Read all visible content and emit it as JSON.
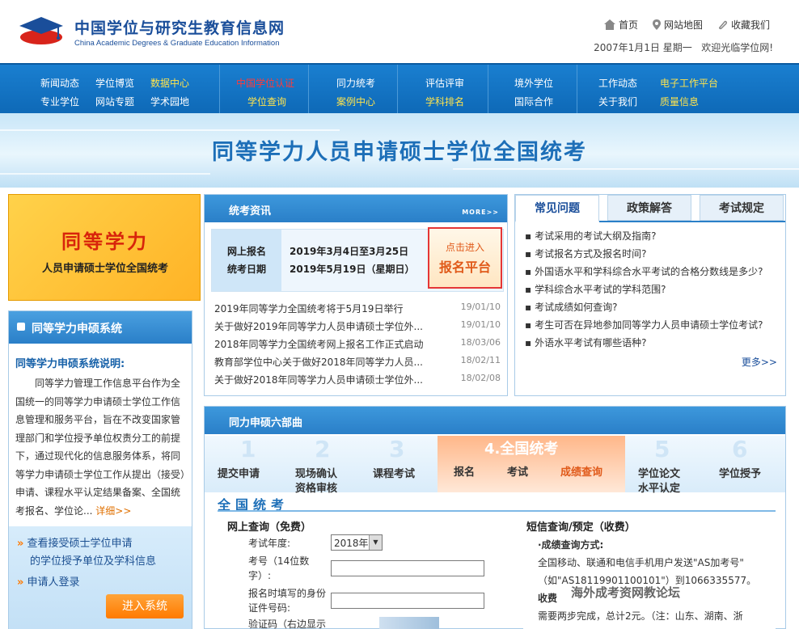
{
  "header": {
    "title": "中国学位与研究生教育信息网",
    "subtitle": "China Academic Degrees & Graduate Education Information",
    "links": [
      "首页",
      "网站地图",
      "收藏我们"
    ],
    "date": "2007年1月1日 星期一",
    "welcome": "欢迎光临学位网!"
  },
  "nav": {
    "rows": [
      [
        "新闻动态",
        "学位博览",
        "数据中心"
      ],
      [
        "专业学位",
        "网站专题",
        "学术园地"
      ]
    ],
    "col2": [
      "中国学位认证",
      "学位查询"
    ],
    "col3": [
      "同力统考",
      "案例中心"
    ],
    "col4": [
      "评估评审",
      "学科排名"
    ],
    "col5": [
      "境外学位",
      "国际合作"
    ],
    "col6a": [
      "工作动态",
      "关于我们"
    ],
    "col6b": [
      "电子工作平台",
      "质量信息"
    ]
  },
  "banner": {
    "title": "同等学力人员申请硕士学位全国统考"
  },
  "promo": {
    "title": "同等学力",
    "subtitle": "人员申请硕士学位全国统考"
  },
  "left_box": {
    "heading": "同等学力申硕系统",
    "sub": "同等学力申硕系统说明:",
    "text": "同等学力管理工作信息平台作为全国统一的同等学力申请硕士学位工作信息管理和服务平台，旨在不改变国家管理部门和学位授予单位权责分工的前提下，通过现代化的信息服务体系，将同等学力申请硕士学位工作从提出（接受）申请、课程水平认定结果备案、全国统考报名、学位论...",
    "more": "详细>>",
    "link1a": "查看接受硕士学位申请",
    "link1b": "的学位授予单位及学科信息",
    "link2": "申请人登录",
    "enter": "进入系统"
  },
  "news": {
    "heading": "统考资讯",
    "more": "MORE>>",
    "reg_label1": "网上报名",
    "reg_label2": "统考日期",
    "reg_value1": "2019年3月4日至3月25日",
    "reg_value2": "2019年5月19日（星期日）",
    "reg_btn_a": "点击进入",
    "reg_btn_b": "报名平台",
    "items": [
      {
        "title": "2019年同等学力全国统考将于5月19日举行",
        "date": "19/01/10"
      },
      {
        "title": "关于做好2019年同等学力人员申请硕士学位外...",
        "date": "19/01/10"
      },
      {
        "title": "2018年同等学力全国统考网上报名工作正式启动",
        "date": "18/03/06"
      },
      {
        "title": "教育部学位中心关于做好2018年同等学力人员...",
        "date": "18/02/11"
      },
      {
        "title": "关于做好2018年同等学力人员申请硕士学位外...",
        "date": "18/02/08"
      }
    ]
  },
  "faq": {
    "tabs": [
      "常见问题",
      "政策解答",
      "考试规定"
    ],
    "items": [
      "考试采用的考试大纲及指南?",
      "考试报名方式及报名时间?",
      "外国语水平和学科综合水平考试的合格分数线是多少?",
      "学科综合水平考试的学科范围?",
      "考试成绩如何查询?",
      "考生可否在异地参加同等学力人员申请硕士学位考试?",
      "外语水平考试有哪些语种?"
    ],
    "more": "更多>>"
  },
  "six": {
    "heading": "同力申硕六部曲",
    "steps": [
      {
        "num": "1",
        "label": "提交申请"
      },
      {
        "num": "2",
        "label": "现场确认",
        "label2": "资格审核"
      },
      {
        "num": "3",
        "label": "课程考试"
      },
      {
        "num": "5",
        "label": "学位论文",
        "label2": "水平认定"
      },
      {
        "num": "6",
        "label": "学位授予"
      }
    ],
    "step4": {
      "title": "4.全国统考",
      "labels": [
        "报名",
        "考试",
        "成绩查询"
      ]
    },
    "section_title": "全国统考",
    "query": {
      "title": "网上查询（免费）",
      "year_label": "考试年度:",
      "year_value": "2018年",
      "exam_no_label_1": "考号（14位数",
      "exam_no_label_2": "字）:",
      "id_label_1": "报名时填写的身份",
      "id_label_2": "证件号码:",
      "captcha_label": "验证码（右边显示"
    },
    "sms": {
      "title": "短信查询/预定（收费）",
      "line1": "·成绩查询方式:",
      "line2": "全国移动、联通和电信手机用户发送\"AS加考号\"",
      "line3": "（如\"AS18119901100101\"）到1066335577。",
      "line4": "收费",
      "line5": "需要两步完成，总计2元。（注：山东、湖南、浙"
    }
  },
  "watermark": "海外成考资网教论坛",
  "colors": {
    "brand": "#1a4e9a",
    "nav": "#1a7fd0",
    "accent": "#ff7a00",
    "red": "#d8240b"
  }
}
